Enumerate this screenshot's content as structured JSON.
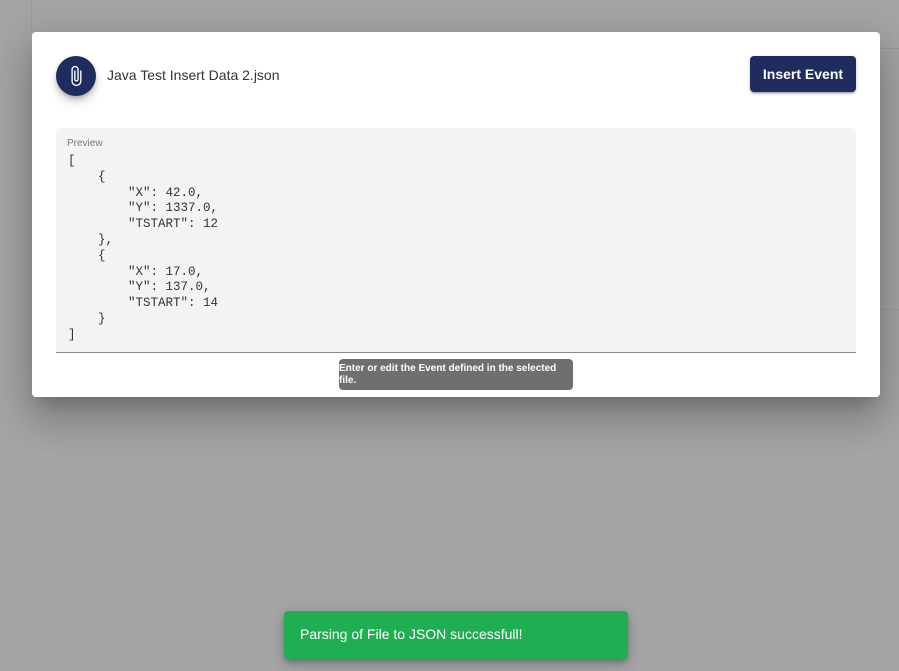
{
  "dialog": {
    "attach_icon": "paperclip-icon",
    "file_name": "Java Test Insert Data 2.json",
    "insert_button_label": "Insert Event",
    "preview": {
      "label": "Preview",
      "content": "[\n    {\n        \"X\": 42.0,\n        \"Y\": 1337.0,\n        \"TSTART\": 12\n    },\n    {\n        \"X\": 17.0,\n        \"Y\": 137.0,\n        \"TSTART\": 14\n    }\n]"
    },
    "tooltip": "Enter or edit the Event defined in the selected file."
  },
  "snackbar": {
    "message": "Parsing of File to JSON successfull!"
  },
  "colors": {
    "primary": "#1e2d5e",
    "success": "#1fae51",
    "backdrop": "#a5a5a5",
    "tooltip": "#6f6f6f"
  }
}
